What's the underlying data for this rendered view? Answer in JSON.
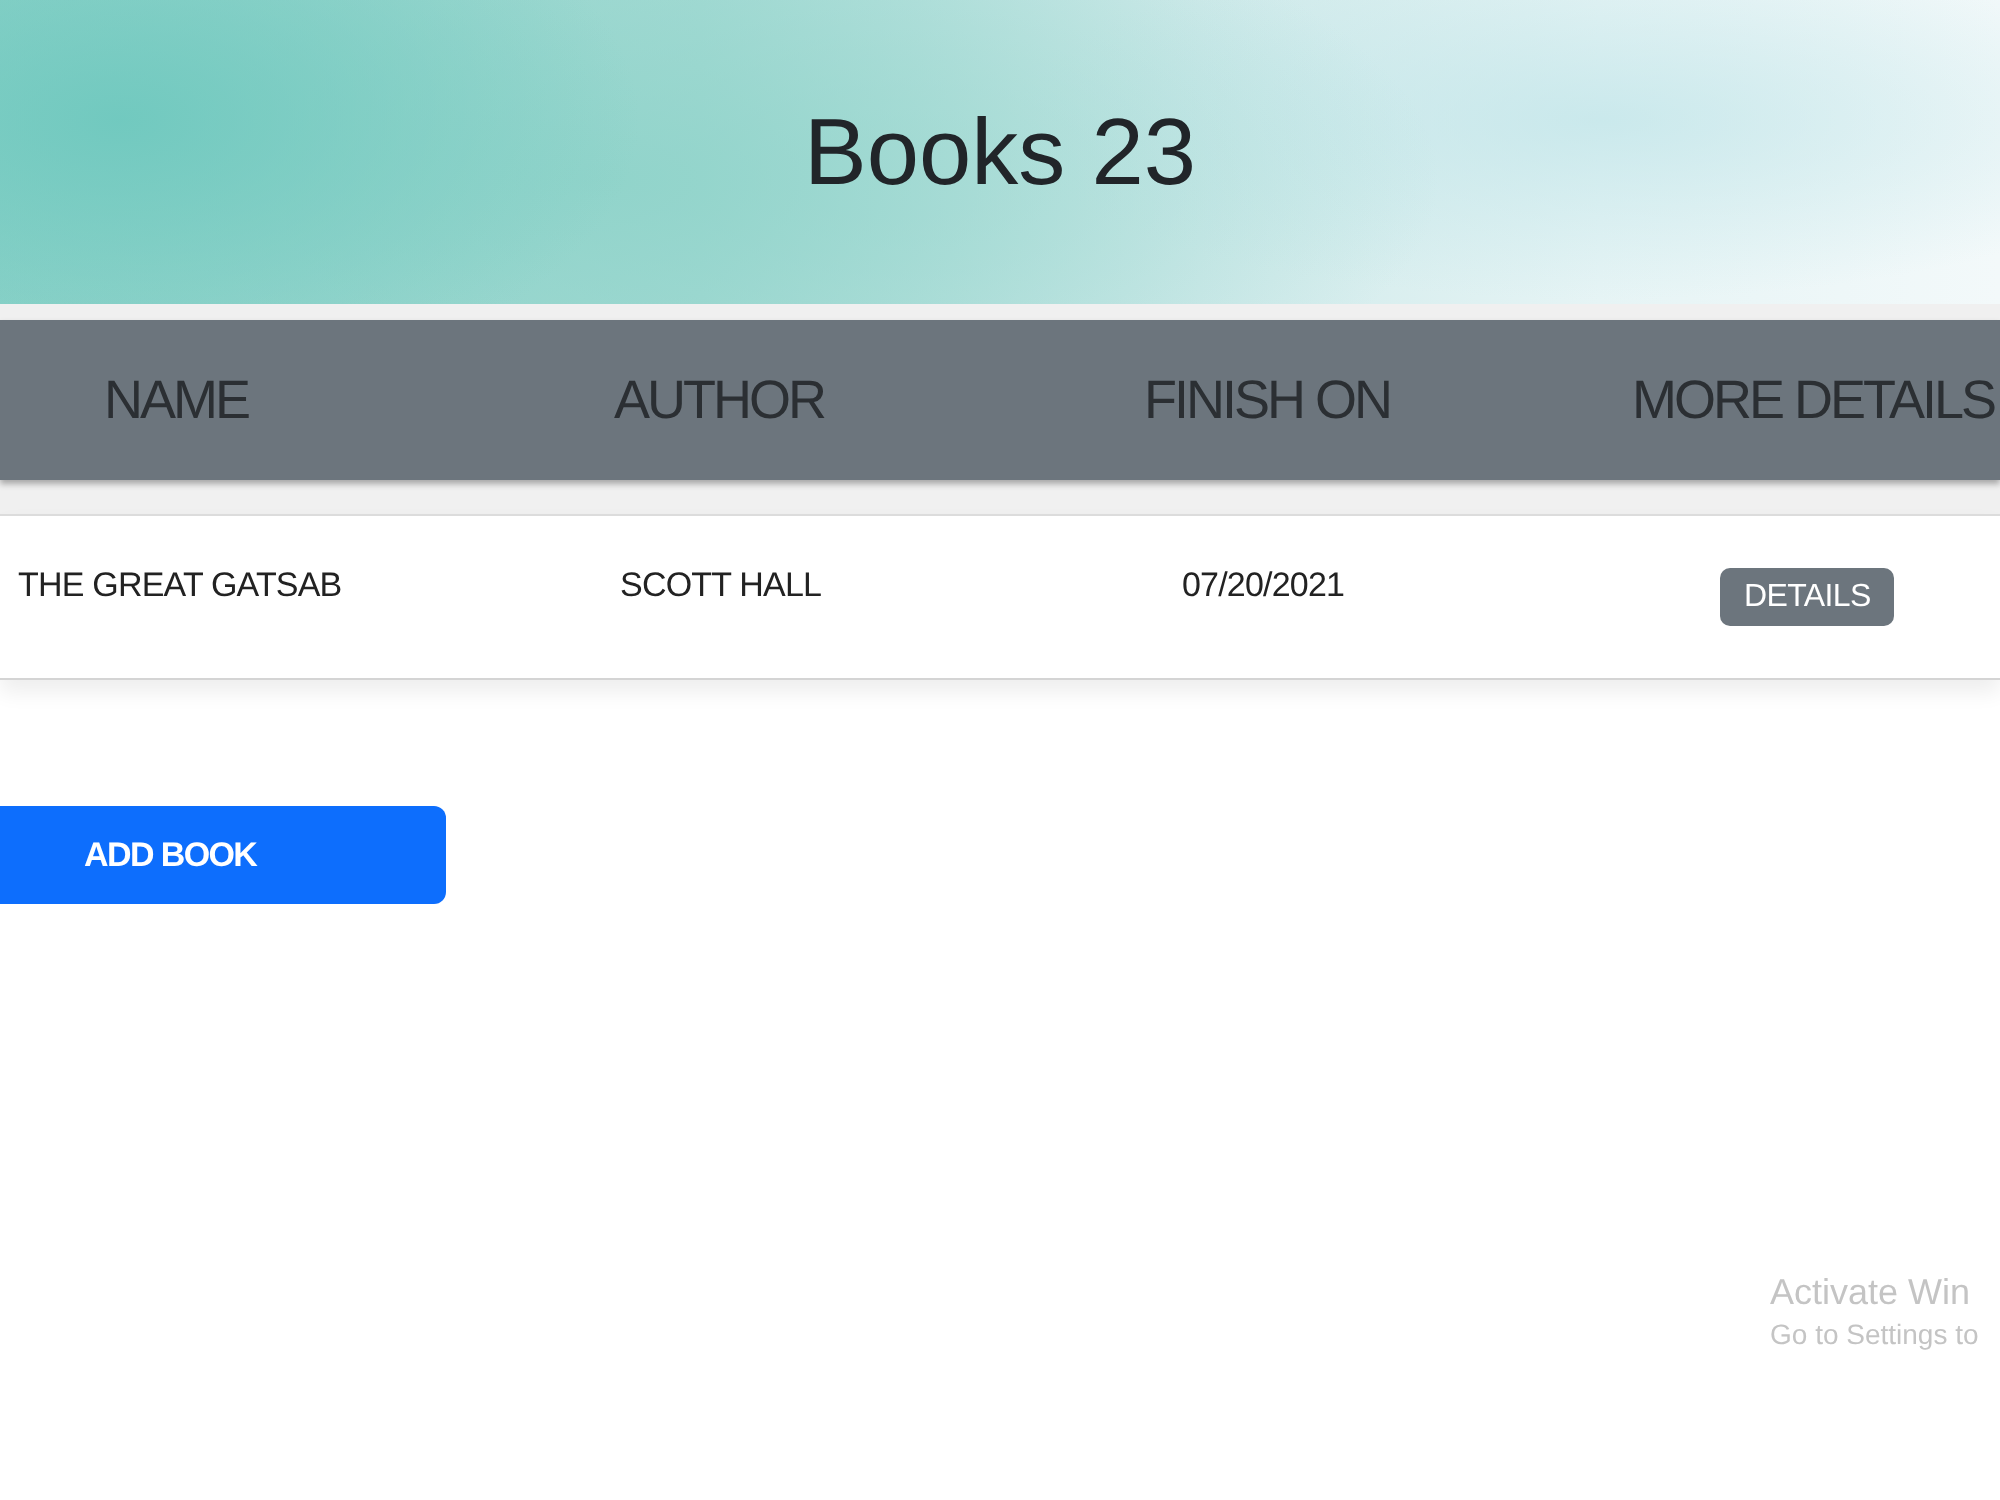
{
  "banner": {
    "title": "Books 23"
  },
  "table": {
    "columns": [
      "NAME",
      "AUTHOR",
      "FINISH ON",
      "MORE DETAILS"
    ],
    "rows": [
      {
        "name": "THE GREAT GATSAB",
        "author": "SCOTT HALL",
        "finish_on": "07/20/2021",
        "details_button": "DETAILS"
      }
    ]
  },
  "add_button": {
    "label": "ADD BOOK"
  },
  "system_notice": {
    "title": "Activate Win",
    "subtitle": "Go to Settings to"
  }
}
